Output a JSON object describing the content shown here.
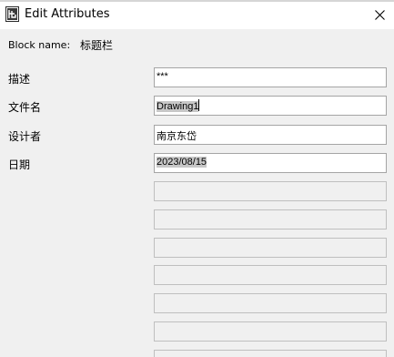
{
  "window": {
    "title": "Edit Attributes",
    "icon": "autocad-app-icon",
    "close_icon": "close-icon"
  },
  "block": {
    "label": "Block name:",
    "value": "标题栏"
  },
  "attributes": [
    {
      "label": "描述",
      "value": "***"
    },
    {
      "label": "文件名",
      "value": "Drawing1"
    },
    {
      "label": "设计者",
      "value": "南京东岱"
    },
    {
      "label": "日期",
      "value": "2023/08/15"
    }
  ],
  "empty_field_count": 7
}
